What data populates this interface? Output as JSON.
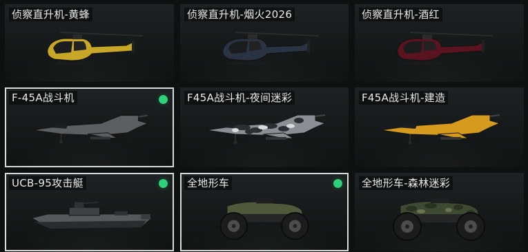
{
  "items": [
    {
      "label": "侦察直升机-黄蜂",
      "equipped": false,
      "selected": false,
      "icon": "helicopter-icon",
      "color": "#c8a628"
    },
    {
      "label": "侦察直升机-烟火2026",
      "equipped": false,
      "selected": false,
      "icon": "helicopter-icon",
      "color": "#2a3344"
    },
    {
      "label": "侦察直升机-酒红",
      "equipped": false,
      "selected": false,
      "icon": "helicopter-icon",
      "color": "#5a1420"
    },
    {
      "label": "F-45A战斗机",
      "equipped": true,
      "selected": true,
      "icon": "jet-icon",
      "color": "#5b5f62"
    },
    {
      "label": "F45A战斗机-夜间迷彩",
      "equipped": false,
      "selected": false,
      "icon": "jet-icon",
      "color": "#8a8f95"
    },
    {
      "label": "F45A战斗机-建造",
      "equipped": false,
      "selected": false,
      "icon": "jet-icon",
      "color": "#d69a1e"
    },
    {
      "label": "UCB-95攻击艇",
      "equipped": true,
      "selected": true,
      "icon": "boat-icon",
      "color": "#55595c"
    },
    {
      "label": "全地形车",
      "equipped": true,
      "selected": true,
      "icon": "atv-icon",
      "color": "#4f5a3c"
    },
    {
      "label": "全地形车-森林迷彩",
      "equipped": false,
      "selected": false,
      "icon": "atv-icon",
      "color": "#3f4a33"
    }
  ],
  "colors": {
    "equipped_dot": "#2fd07a",
    "selected_border": "#d9dcd8"
  }
}
